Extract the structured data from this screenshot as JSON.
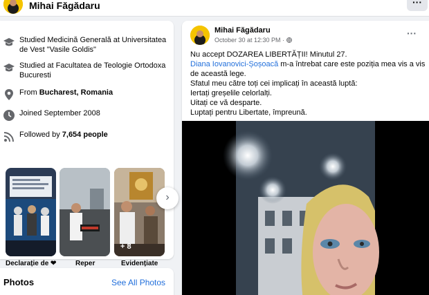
{
  "header": {
    "name": "Mihai Făgădaru",
    "more_label": "···"
  },
  "intro": {
    "items": [
      {
        "icon": "graduation-cap-icon",
        "text": "Studied Medicină Generală at Universitatea de Vest \"Vasile Goldis\""
      },
      {
        "icon": "graduation-cap-icon",
        "text": "Studied at Facultatea de Teologie Ortodoxa Bucuresti"
      },
      {
        "icon": "location-pin-icon",
        "prefix": "From ",
        "bold": "Bucharest, Romania"
      },
      {
        "icon": "clock-icon",
        "text": "Joined September 2008"
      },
      {
        "icon": "rss-icon",
        "prefix": "Followed by ",
        "bold": "7,654 people"
      }
    ],
    "highlights": [
      {
        "label": "Declarație de ❤"
      },
      {
        "label": "Reper"
      },
      {
        "label": "Evidențiate",
        "overlay": "+ 8"
      }
    ]
  },
  "photos": {
    "title": "Photos",
    "see_all": "See All Photos"
  },
  "post": {
    "author": "Mihai Făgădaru",
    "date": "October 30 at 12:30 PM",
    "separator": "·",
    "more_label": "···",
    "line1": "Nu accept DOZAREA LIBERTĂȚII! Minutul 27.",
    "mention": "Diana Iovanovici-Șoșoacă",
    "line2_rest": " m-a întrebat care este poziția mea vis a vis de această lege.",
    "line3": "Sfatul meu către toți cei implicați în această luptă:",
    "line4": "Iertați greșelile celorlalți.",
    "line5": "Uitați ce vă desparte.",
    "line6": "Luptați pentru Libertate, împreună."
  },
  "colors": {
    "accent": "#216fdb",
    "background": "#f0f2f5"
  }
}
